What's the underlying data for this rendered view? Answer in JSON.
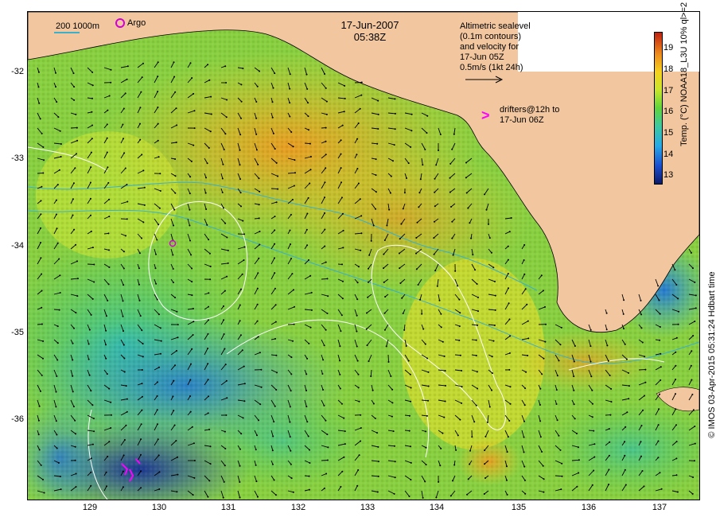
{
  "header": {
    "date": "17-Jun-2007",
    "time": "05:38Z"
  },
  "legend": {
    "scale_text": "200  1000m",
    "argo_label": "Argo",
    "altimetry_lines": [
      "Altimetric sealevel",
      "(0.1m contours)",
      "and velocity for",
      "17-Jun 05Z",
      "0.5m/s (1kt 24h)"
    ],
    "drifter_lines": [
      "drifters@12h to",
      "17-Jun 06Z"
    ]
  },
  "axes": {
    "y_labels": [
      "-32",
      "-33",
      "-34",
      "-35",
      "-36"
    ],
    "x_labels": [
      "129",
      "130",
      "131",
      "132",
      "133",
      "134",
      "135",
      "136",
      "137"
    ]
  },
  "colorbar": {
    "label": "Temp. (°C) NOAA18_L3U 10% ql>=2",
    "ticks": [
      "13",
      "14",
      "15",
      "16",
      "17",
      "18",
      "19"
    ],
    "range": [
      12.8,
      19.7
    ],
    "colors": {
      "low": "#0c1a6b",
      "mid": "#5fd43c",
      "high": "#c02010",
      "land": "#f2c7a0",
      "argo": "#d400d4",
      "drifter": "#ff00ff",
      "contour_isobath": "#3bb0c8"
    }
  },
  "credit": "© IMOS 03-Apr-2015 05:31:24 Hdbart time"
}
